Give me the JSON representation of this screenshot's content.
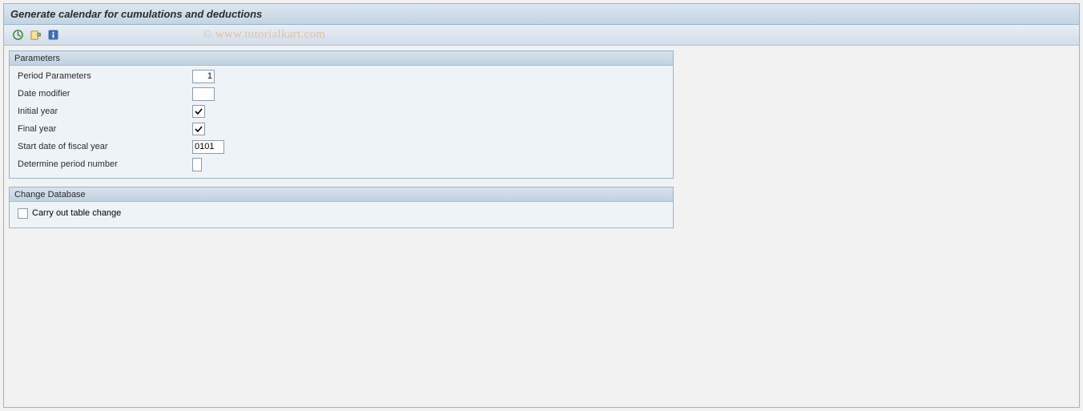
{
  "title": "Generate calendar for cumulations and deductions",
  "watermark": "© www.tutorialkart.com",
  "toolbar": {
    "execute": "execute",
    "variant": "variant",
    "info": "info"
  },
  "groups": {
    "parameters": {
      "title": "Parameters",
      "fields": {
        "period_parameters": {
          "label": "Period Parameters",
          "value": "1"
        },
        "date_modifier": {
          "label": "Date modifier",
          "value": ""
        },
        "initial_year": {
          "label": "Initial year",
          "checked": true
        },
        "final_year": {
          "label": "Final year",
          "checked": true
        },
        "start_date_fy": {
          "label": "Start date of fiscal year",
          "value": "0101"
        },
        "determine_pn": {
          "label": "Determine period number",
          "value": ""
        }
      }
    },
    "change_db": {
      "title": "Change Database",
      "carry_out": {
        "label": "Carry out table change",
        "checked": false
      }
    }
  }
}
